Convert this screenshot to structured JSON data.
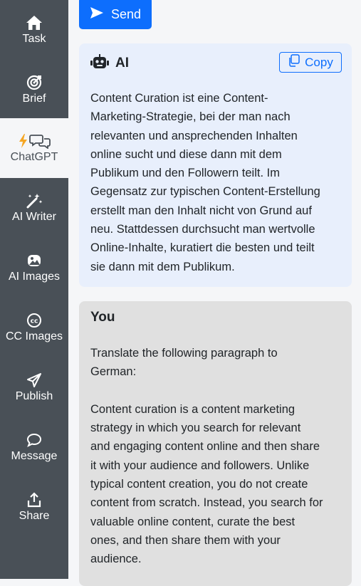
{
  "sidebar": {
    "items": [
      {
        "label": "Task",
        "icon": "home-icon"
      },
      {
        "label": "Brief",
        "icon": "target-icon"
      },
      {
        "label": "ChatGPT",
        "icon": "lightning-chat-icon",
        "active": true
      },
      {
        "label": "AI Writer",
        "icon": "magic-wand-icon"
      },
      {
        "label": "AI Images",
        "icon": "image-icon"
      },
      {
        "label": "CC Images",
        "icon": "creative-commons-icon"
      },
      {
        "label": "Publish",
        "icon": "send-icon"
      },
      {
        "label": "Message",
        "icon": "chat-bubble-icon"
      },
      {
        "label": "Share",
        "icon": "share-icon"
      }
    ]
  },
  "toolbar": {
    "send_label": "Send"
  },
  "ai_card": {
    "title": "AI",
    "copy_label": "Copy",
    "text": "Content Curation ist eine Content-\nMarketing-Strategie, bei der man nach\nrelevanten und ansprechenden Inhalten\nonline sucht und diese dann mit dem\nPublikum und den Followern teilt. Im\nGegensatz zur typischen Content-Erstellung\nerstellt man den Inhalt nicht von Grund auf\nneu. Stattdessen durchsucht man wertvolle\nOnline-Inhalte, kuratiert die besten und teilt\nsie dann mit dem Publikum."
  },
  "user_card": {
    "title": "You",
    "text": "Translate the following paragraph to\nGerman:\n\nContent curation is a content marketing\nstrategy in which you search for relevant\nand engaging content online and then share\nit with your audience and followers. Unlike\ntypical content creation, you do not create\ncontent from scratch. Instead, you search for\nvaluable online content, curate the best\nones, and then share them with your\naudience."
  },
  "colors": {
    "sidebar_bg": "#495057",
    "accent": "#0d6efd",
    "ai_card_bg": "#e8effc",
    "user_card_bg": "#e0e0e0",
    "lightning": "#f5a623"
  }
}
